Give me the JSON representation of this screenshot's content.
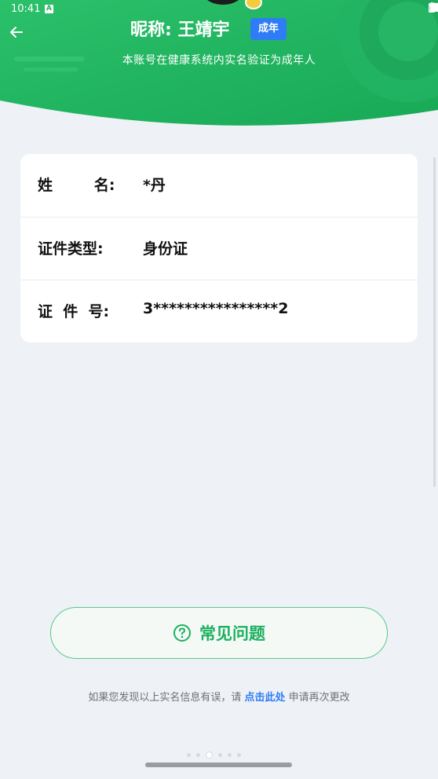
{
  "status_bar": {
    "time": "10:41",
    "app_icon_letter": "A"
  },
  "header": {
    "nickname": "昵称: 王靖宇",
    "adult_badge": "成年",
    "verify_text": "本账号在健康系统内实名验证为成年人"
  },
  "info_rows": [
    {
      "label": "姓        名:",
      "value": "*丹"
    },
    {
      "label": "证件类型:",
      "value": "身份证"
    },
    {
      "label": "证  件  号:",
      "value": "3****************2"
    }
  ],
  "faq_button": {
    "label": "常见问题",
    "icon": "question-circle-icon"
  },
  "footer": {
    "text_before": "如果您发现以上实名信息有误，请",
    "link": "点击此处",
    "text_after": "申请再次更改"
  },
  "colors": {
    "brand_green": "#1db15f",
    "accent_blue": "#2f7df6",
    "background": "#eef1f6"
  }
}
